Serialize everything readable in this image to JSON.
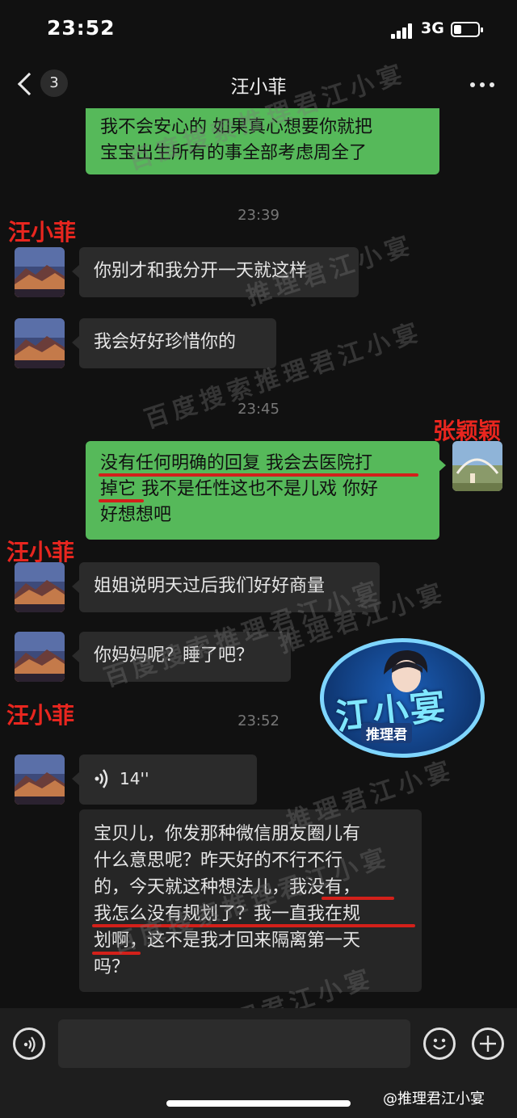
{
  "status": {
    "time": "23:52",
    "network": "3G"
  },
  "nav": {
    "back_count": "3",
    "title": "汪小菲"
  },
  "messages": {
    "out1_line1": "我不会安心的 如果真心想要你就把",
    "out1_line2": "宝宝出生所有的事全部考虑周全了",
    "ts1": "23:39",
    "in1": "你别才和我分开一天就这样",
    "in2": "我会好好珍惜你的",
    "ts2": "23:45",
    "out2_line1": "没有任何明确的回复 我会去医院打",
    "out2_line2": "掉它 我不是任性这也不是儿戏 你好",
    "out2_line3": "好想想吧",
    "in3": "姐姐说明天过后我们好好商量",
    "in4": "你妈妈呢？睡了吧？",
    "ts3": "23:52",
    "voice_duration": "14''",
    "trans_line1": "宝贝儿，你发那种微信朋友圈儿有",
    "trans_line2": "什么意思呢？昨天好的不行不行",
    "trans_line3": "的，今天就这种想法儿，我没有，",
    "trans_line4": "我怎么没有规划了？我一直我在规",
    "trans_line5": "划啊，这不是我才回来隔离第一天",
    "trans_line6": "吗？"
  },
  "labels": {
    "left_name": "汪小菲",
    "right_name": "张颖颖"
  },
  "watermark": {
    "text1": "百度搜索推理君江小宴",
    "text2": "推理君江小宴"
  },
  "logo": {
    "big": "江小宴",
    "small": "推理君"
  },
  "credit": "@推理君江小宴",
  "colors": {
    "bubble_out": "#56b95a",
    "bubble_in": "#2b2b2b",
    "annotation_red": "#e8261f"
  }
}
